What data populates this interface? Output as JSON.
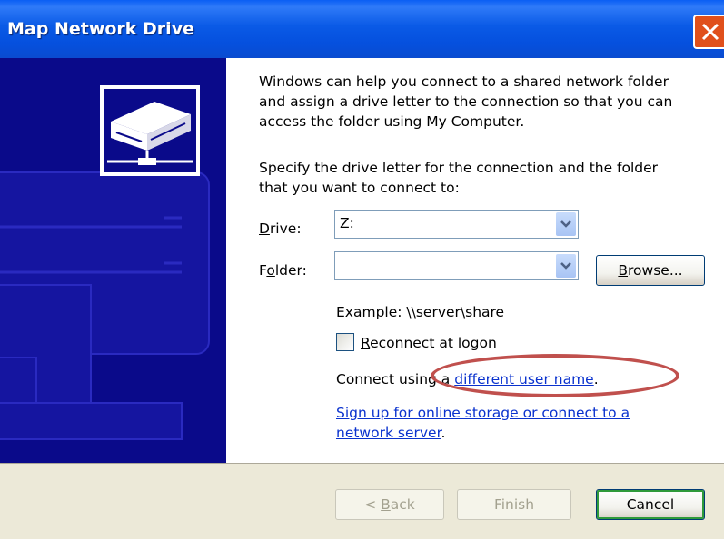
{
  "window": {
    "title": "Map Network Drive"
  },
  "intro": {
    "line1": "Windows can help you connect to a shared network folder",
    "line2": "and assign a drive letter to the connection so that you can",
    "line3": "access the folder using My Computer."
  },
  "instruction": {
    "line1": "Specify the drive letter for the connection and the folder",
    "line2": "that you want to connect to:"
  },
  "drive": {
    "label_key": "D",
    "label_rest": "rive:",
    "value": "Z:"
  },
  "folder": {
    "label_pre": "F",
    "label_key": "o",
    "label_rest": "lder:",
    "value": ""
  },
  "browse": {
    "label_key": "B",
    "label_rest": "rowse..."
  },
  "example": "Example: \\\\server\\share",
  "reconnect": {
    "label_key": "R",
    "label_rest": "econnect at logon",
    "checked": false
  },
  "connect_as": {
    "prefix": "Connect using a ",
    "link": "different user name",
    "suffix": "."
  },
  "signup": {
    "line1": "Sign up for online storage or connect to a",
    "line2": "network server",
    "suffix": "."
  },
  "buttons": {
    "back_pre": "< ",
    "back_key": "B",
    "back_rest": "ack",
    "finish": "Finish",
    "cancel": "Cancel"
  },
  "colors": {
    "titlebar": "#0a5ae6",
    "side_panel": "#0a0a8a",
    "link": "#0a32ce",
    "annotation": "#c0504d"
  }
}
